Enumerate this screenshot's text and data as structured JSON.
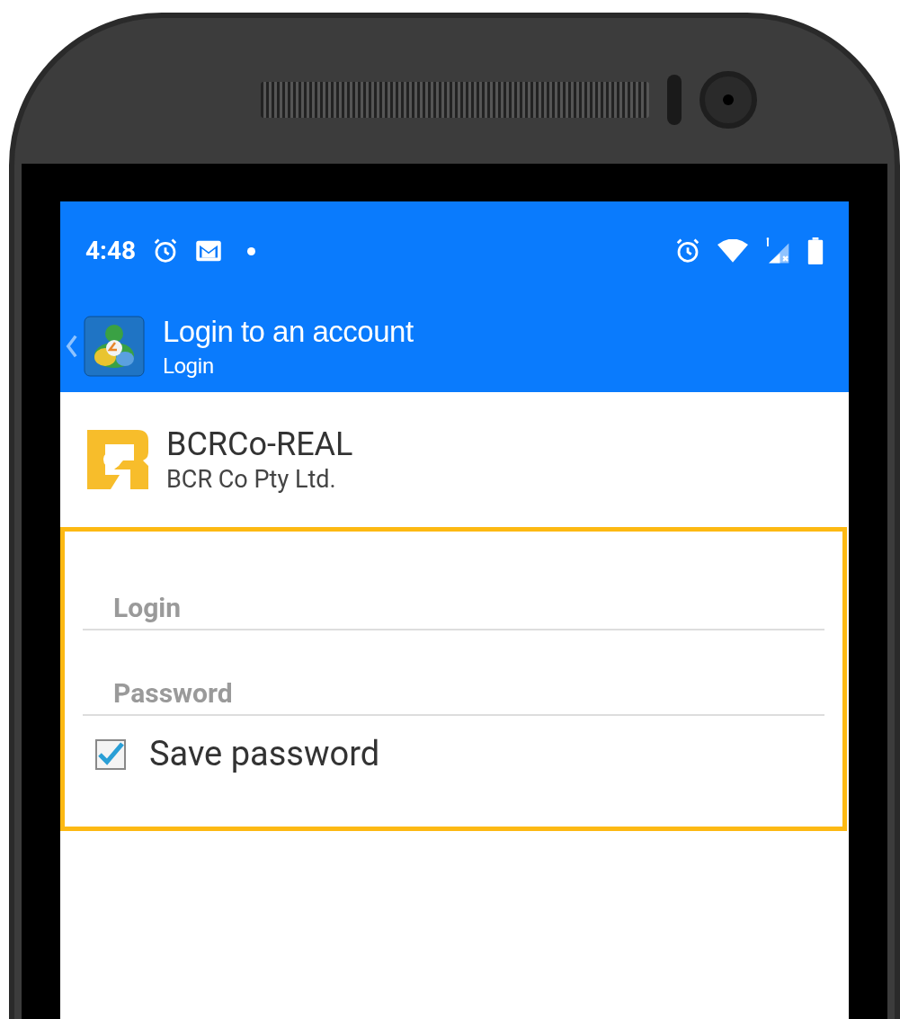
{
  "status_bar": {
    "time": "4:48"
  },
  "app_bar": {
    "title": "Login to an account",
    "subtitle": "Login"
  },
  "server": {
    "name": "BCRCo-REAL",
    "company": "BCR Co Pty Ltd."
  },
  "form": {
    "fields": [
      {
        "placeholder": "Login"
      },
      {
        "placeholder": "Password"
      }
    ],
    "save_password": {
      "label": "Save password",
      "checked": true
    }
  }
}
